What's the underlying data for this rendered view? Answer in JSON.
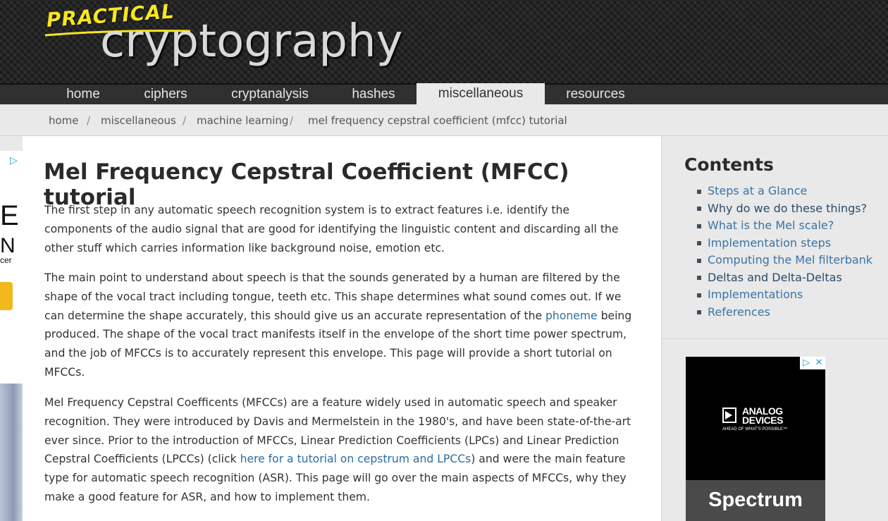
{
  "logo": {
    "top_text": "PRACTICAL",
    "main_text": "cryptography"
  },
  "nav": {
    "items": [
      {
        "label": "home"
      },
      {
        "label": "ciphers"
      },
      {
        "label": "cryptanalysis"
      },
      {
        "label": "hashes"
      },
      {
        "label": "miscellaneous",
        "active": true
      },
      {
        "label": "resources"
      }
    ]
  },
  "breadcrumb": {
    "items": [
      "home",
      "miscellaneous",
      "machine learning",
      "mel frequency cepstral coefficient (mfcc) tutorial"
    ],
    "separator": "/"
  },
  "article": {
    "title": "Mel Frequency Cepstral Coefficient (MFCC) tutorial",
    "p1": "The first step in any automatic speech recognition system is to extract features i.e. identify the components of the audio signal that are good for identifying the linguistic content and discarding all the other stuff which carries information like background noise, emotion etc.",
    "p2_a": "The main point to understand about speech is that the sounds generated by a human are filtered by the shape of the vocal tract including tongue, teeth etc. This shape determines what sound comes out. If we can determine the shape accurately, this should give us an accurate representation of the ",
    "p2_link": "phoneme",
    "p2_b": " being produced. The shape of the vocal tract manifests itself in the envelope of the short time power spectrum, and the job of MFCCs is to accurately represent this envelope. This page will provide a short tutorial on MFCCs.",
    "p3_a": "Mel Frequency Cepstral Coefficents (MFCCs) are a feature widely used in automatic speech and speaker recognition. They were introduced by Davis and Mermelstein in the 1980's, and have been state-of-the-art ever since. Prior to the introduction of MFCCs, Linear Prediction Coefficients (LPCs) and Linear Prediction Cepstral Coefficients (LPCCs) (click ",
    "p3_link": "here for a tutorial on cepstrum and LPCCs",
    "p3_b": ") and were the main feature type for automatic speech recognition (ASR). This page will go over the main aspects of MFCCs, why they make a good feature for ASR, and how to implement them."
  },
  "toc": {
    "title": "Contents",
    "items": [
      "Steps at a Glance",
      "Why do we do these things?",
      "What is the Mel scale?",
      "Implementation steps",
      "Computing the Mel filterbank",
      "Deltas and Delta-Deltas",
      "Implementations",
      "References"
    ]
  },
  "left_ad": {
    "letter_top": "E",
    "letter_mid": "N",
    "letter_small": "cer"
  },
  "side_ad": {
    "brand_line1": "ANALOG",
    "brand_line2": "DEVICES",
    "tagline": "AHEAD OF WHAT'S POSSIBLE™",
    "headline": "Spectrum"
  },
  "colors": {
    "link": "#2e6c9e",
    "logo_yellow": "#f5e61f",
    "nav_bg": "#303030"
  }
}
